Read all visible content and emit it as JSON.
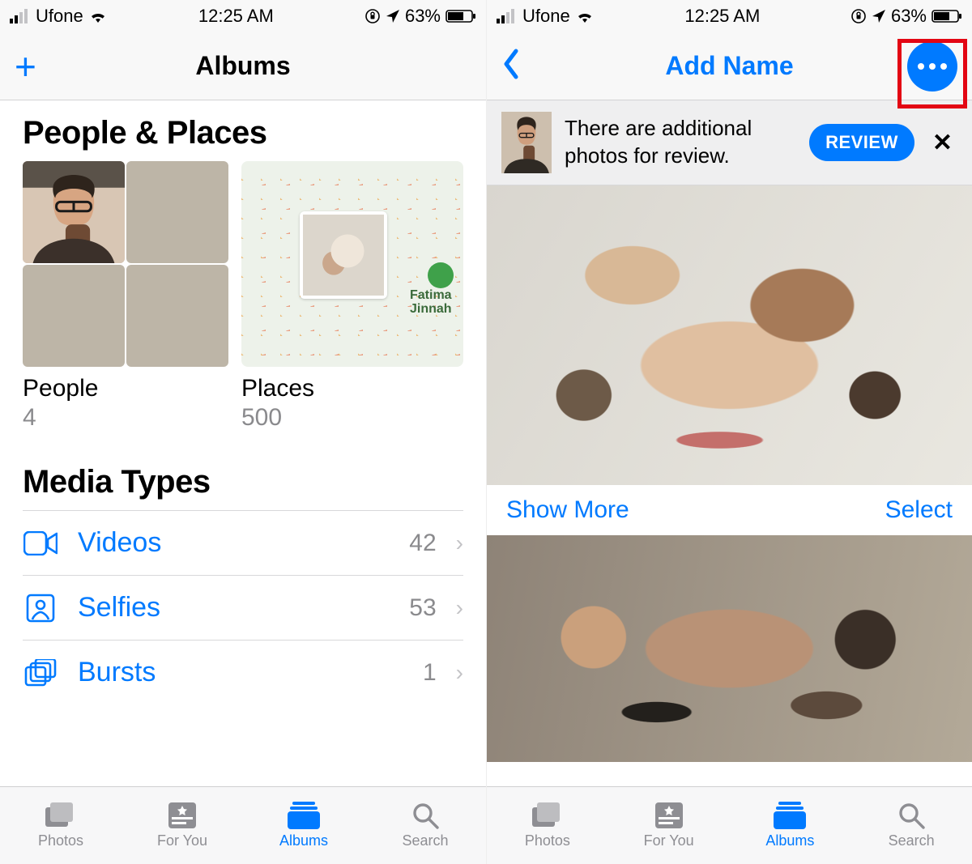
{
  "status": {
    "carrier": "Ufone",
    "time": "12:25 AM",
    "battery_pct": "63%"
  },
  "left": {
    "nav_title": "Albums",
    "section_people_places": "People & Places",
    "people_label": "People",
    "people_count": "4",
    "places_label": "Places",
    "places_count": "500",
    "map_place_label": "Fatima Jinnah",
    "section_media_types": "Media Types",
    "media": [
      {
        "label": "Videos",
        "count": "42"
      },
      {
        "label": "Selfies",
        "count": "53"
      },
      {
        "label": "Bursts",
        "count": "1"
      }
    ]
  },
  "right": {
    "nav_title": "Add Name",
    "banner_text": "There are additional photos for review.",
    "review_label": "REVIEW",
    "show_more": "Show More",
    "select": "Select"
  },
  "tabs": {
    "photos": "Photos",
    "for_you": "For You",
    "albums": "Albums",
    "search": "Search"
  }
}
